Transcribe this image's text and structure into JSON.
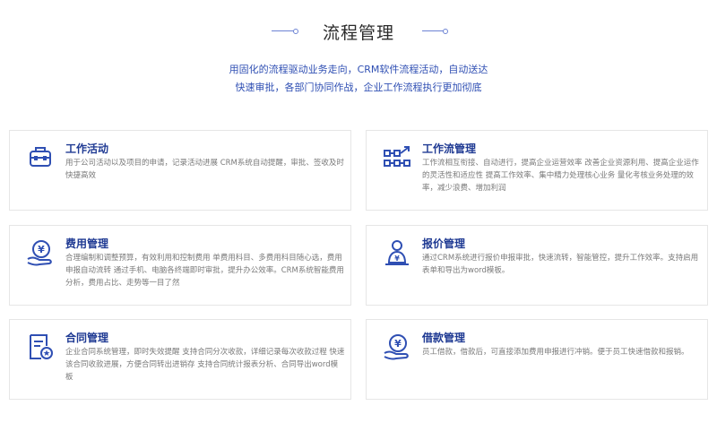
{
  "header": {
    "title": "流程管理",
    "subtitle_line1": "用固化的流程驱动业务走向，CRM软件流程活动，自动送达",
    "subtitle_line2": "快速审批，各部门协同作战，企业工作流程执行更加彻底"
  },
  "cards": [
    {
      "icon": "toolbox-icon",
      "title": "工作活动",
      "desc": "用于公司活动以及项目的申请，记录活动进展 CRM系统自动提醒，审批、签收及时快捷高效"
    },
    {
      "icon": "workflow-icon",
      "title": "工作流管理",
      "desc": "工作流相互衔接、自动进行，提高企业运营效率 改善企业资源利用、提高企业运作的灵活性和适应性 提高工作效率、集中精力处理核心业务 量化考核业务处理的效率，减少浪费、增加利润"
    },
    {
      "icon": "yen-hand-icon",
      "title": "费用管理",
      "desc": "合理编制和调整预算，有效利用和控制费用 单费用科目、多费用科目随心选，费用申报自动流转 通过手机、电脑各终端即时审批，提升办公效率。CRM系统智能费用分析，费用占比、走势等一目了然"
    },
    {
      "icon": "quote-person-icon",
      "title": "报价管理",
      "desc": "通过CRM系统进行报价申报审批，快速流转，智能管控，提升工作效率。支持启用表单和导出为word模板。"
    },
    {
      "icon": "contract-icon",
      "title": "合同管理",
      "desc": "企业合同系统管理，即时失效提醒 支持合同分次收款，详细记录每次收款过程 快速该合同收款进展，方便合同转出进销存 支持合同统计报表分析、合同导出word模板"
    },
    {
      "icon": "yen-hand-icon",
      "title": "借款管理",
      "desc": "员工借款，借款后，可直接添加费用申报进行冲销。便于员工快速借款和报销。"
    }
  ],
  "colors": {
    "accent": "#1f3a93",
    "icon": "#2f4fb3",
    "text": "#7a7a7a"
  }
}
